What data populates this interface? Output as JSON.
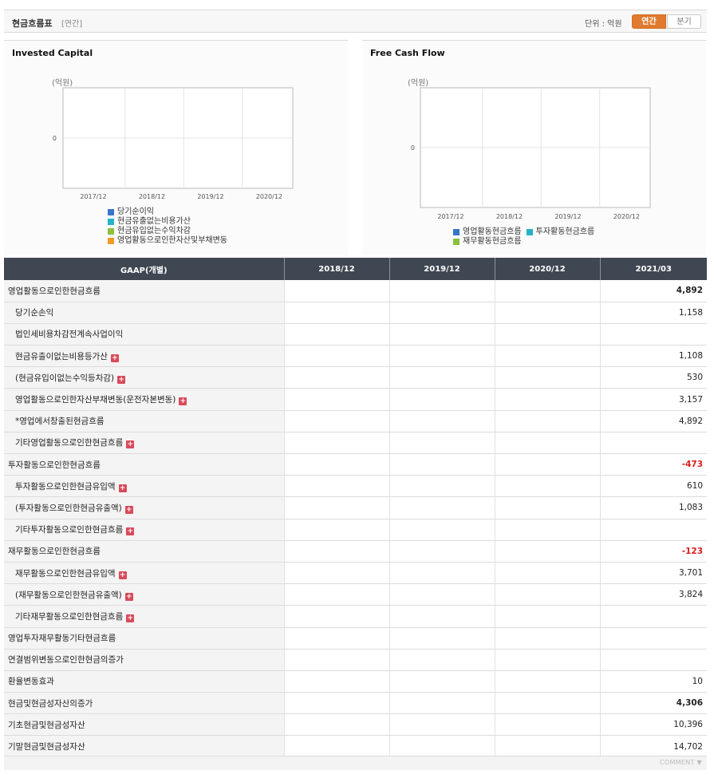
{
  "header": {
    "title": "현금흐름표",
    "subtitle": "[연간]",
    "unit": "단위 : 억원",
    "btn_annual": "연간",
    "btn_quarter": "분기"
  },
  "charts": [
    {
      "title": "Invested Capital",
      "unit_label": "(억원)",
      "zero_label": "0",
      "x_ticks": [
        "2017/12",
        "2018/12",
        "2019/12",
        "2020/12"
      ],
      "legend": [
        {
          "label": "당기순이익",
          "color": "#3a74c9"
        },
        {
          "label": "현금유출없는비용가산",
          "color": "#26b3c9"
        },
        {
          "label": "현금유입없는수익차감",
          "color": "#8bbf3d"
        },
        {
          "label": "영업활동으로인한자산및부채변동",
          "color": "#f29b22"
        }
      ]
    },
    {
      "title": "Free Cash Flow",
      "unit_label": "(억원)",
      "zero_label": "0",
      "x_ticks": [
        "2017/12",
        "2018/12",
        "2019/12",
        "2020/12"
      ],
      "legend": [
        {
          "label": "영업활동현금흐름",
          "color": "#3a74c9"
        },
        {
          "label": "투자활동현금흐름",
          "color": "#26b3c9"
        },
        {
          "label": "재무활동현금흐름",
          "color": "#8bbf3d"
        }
      ]
    }
  ],
  "table": {
    "headers": [
      "GAAP(개별)",
      "2018/12",
      "2019/12",
      "2020/12",
      "2021/03"
    ],
    "rows": [
      {
        "label": "영업활동으로인한현금흐름",
        "level": 0,
        "plus": false,
        "v": [
          "",
          "",
          "",
          "4,892"
        ],
        "style": "bold"
      },
      {
        "label": "당기순손익",
        "level": 1,
        "plus": false,
        "v": [
          "",
          "",
          "",
          "1,158"
        ],
        "style": ""
      },
      {
        "label": "법인세비용차감전계속사업이익",
        "level": 1,
        "plus": false,
        "v": [
          "",
          "",
          "",
          ""
        ],
        "style": ""
      },
      {
        "label": "현금유출이없는비용등가산",
        "level": 1,
        "plus": true,
        "v": [
          "",
          "",
          "",
          "1,108"
        ],
        "style": ""
      },
      {
        "label": "(현금유입이없는수익등차감)",
        "level": 1,
        "plus": true,
        "v": [
          "",
          "",
          "",
          "530"
        ],
        "style": ""
      },
      {
        "label": "영업활동으로인한자산부채변동(운전자본변동)",
        "level": 1,
        "plus": true,
        "v": [
          "",
          "",
          "",
          "3,157"
        ],
        "style": ""
      },
      {
        "label": "*영업에서창출된현금흐름",
        "level": 1,
        "plus": false,
        "v": [
          "",
          "",
          "",
          "4,892"
        ],
        "style": ""
      },
      {
        "label": "기타영업활동으로인한현금흐름",
        "level": 1,
        "plus": true,
        "v": [
          "",
          "",
          "",
          ""
        ],
        "style": ""
      },
      {
        "label": "투자활동으로인한현금흐름",
        "level": 0,
        "plus": false,
        "v": [
          "",
          "",
          "",
          "-473"
        ],
        "style": "neg"
      },
      {
        "label": "투자활동으로인한현금유입액",
        "level": 1,
        "plus": true,
        "v": [
          "",
          "",
          "",
          "610"
        ],
        "style": ""
      },
      {
        "label": "(투자활동으로인한현금유출액)",
        "level": 1,
        "plus": true,
        "v": [
          "",
          "",
          "",
          "1,083"
        ],
        "style": ""
      },
      {
        "label": "기타투자활동으로인한현금흐름",
        "level": 1,
        "plus": true,
        "v": [
          "",
          "",
          "",
          ""
        ],
        "style": ""
      },
      {
        "label": "재무활동으로인한현금흐름",
        "level": 0,
        "plus": false,
        "v": [
          "",
          "",
          "",
          "-123"
        ],
        "style": "neg"
      },
      {
        "label": "재무활동으로인한현금유입액",
        "level": 1,
        "plus": true,
        "v": [
          "",
          "",
          "",
          "3,701"
        ],
        "style": ""
      },
      {
        "label": "(재무활동으로인한현금유출액)",
        "level": 1,
        "plus": true,
        "v": [
          "",
          "",
          "",
          "3,824"
        ],
        "style": ""
      },
      {
        "label": "기타재무활동으로인한현금흐름",
        "level": 1,
        "plus": true,
        "v": [
          "",
          "",
          "",
          ""
        ],
        "style": ""
      },
      {
        "label": "영업투자재무활동기타현금흐름",
        "level": 0,
        "plus": false,
        "v": [
          "",
          "",
          "",
          ""
        ],
        "style": ""
      },
      {
        "label": "연결범위변동으로인한현금의증가",
        "level": 0,
        "plus": false,
        "v": [
          "",
          "",
          "",
          ""
        ],
        "style": ""
      },
      {
        "label": "환율변동효과",
        "level": 0,
        "plus": false,
        "v": [
          "",
          "",
          "",
          "10"
        ],
        "style": ""
      },
      {
        "label": "현금및현금성자산의증가",
        "level": 0,
        "plus": false,
        "v": [
          "",
          "",
          "",
          "4,306"
        ],
        "style": "bold"
      },
      {
        "label": "기초현금및현금성자산",
        "level": 0,
        "plus": false,
        "v": [
          "",
          "",
          "",
          "10,396"
        ],
        "style": ""
      },
      {
        "label": "기말현금및현금성자산",
        "level": 0,
        "plus": false,
        "v": [
          "",
          "",
          "",
          "14,702"
        ],
        "style": ""
      }
    ]
  },
  "footer": {
    "comment": "COMMENT ▼"
  }
}
